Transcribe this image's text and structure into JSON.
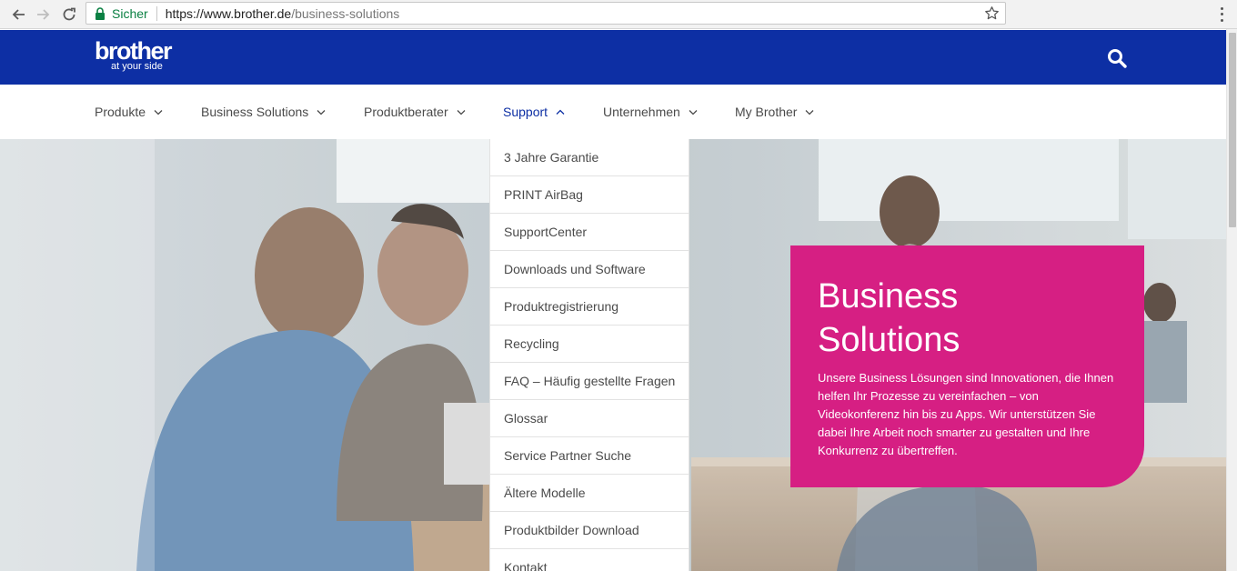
{
  "browser": {
    "secure_label": "Sicher",
    "url_host": "https://www.brother.de",
    "url_path": "/business-solutions"
  },
  "header": {
    "logo_word": "brother",
    "logo_tagline": "at your side"
  },
  "nav": {
    "items": [
      {
        "label": "Produkte"
      },
      {
        "label": "Business Solutions"
      },
      {
        "label": "Produktberater"
      },
      {
        "label": "Support"
      },
      {
        "label": "Unternehmen"
      },
      {
        "label": "My Brother"
      }
    ],
    "active_item": "Support"
  },
  "dropdown": {
    "items": [
      {
        "label": "3 Jahre Garantie"
      },
      {
        "label": "PRINT AirBag"
      },
      {
        "label": "SupportCenter"
      },
      {
        "label": "Downloads und Software"
      },
      {
        "label": "Produktregistrierung"
      },
      {
        "label": "Recycling"
      },
      {
        "label": "FAQ – Häufig gestellte Fragen"
      },
      {
        "label": "Glossar"
      },
      {
        "label": "Service Partner Suche"
      },
      {
        "label": "Ältere Modelle"
      },
      {
        "label": "Produktbilder Download"
      },
      {
        "label": "Kontakt"
      }
    ]
  },
  "hero": {
    "title_line1": "Business",
    "title_line2": "Solutions",
    "text": "Unsere Business Lösungen sind Innovationen, die Ihnen helfen Ihr Prozesse zu vereinfachen – von Videokonferenz hin bis zu Apps. Wir unterstützen Sie dabei Ihre Arbeit noch smarter zu gestalten und Ihre Konkurrenz zu übertreffen."
  },
  "colors": {
    "brand_blue": "#0d2fa4",
    "promo_magenta": "#d61f83",
    "secure_green": "#0b8043"
  },
  "icons": {
    "back": "arrow-left-icon",
    "forward": "arrow-right-icon",
    "reload": "reload-icon",
    "lock": "lock-icon",
    "bookmark": "star-icon",
    "menu": "kebab-menu-icon",
    "search": "search-icon",
    "chevron": "chevron-down-icon"
  }
}
